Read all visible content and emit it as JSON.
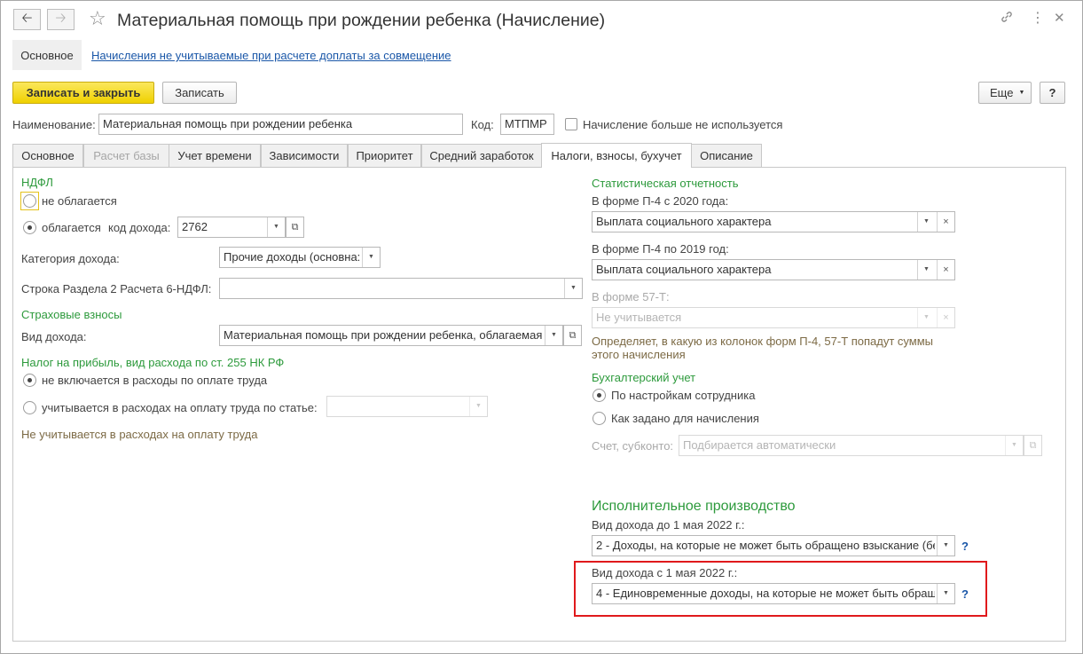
{
  "window": {
    "title": "Материальная помощь при рождении ребенка (Начисление)"
  },
  "icons": {
    "back": "arrow-left-icon",
    "forward": "arrow-right-icon",
    "favorite": "star-icon",
    "link": "link-icon",
    "menu": "more-vertical-icon",
    "close": "close-icon"
  },
  "top_nav": {
    "main": "Основное",
    "link": "Начисления не учитываемые при расчете доплаты за совмещение"
  },
  "toolbar": {
    "save_close": "Записать и закрыть",
    "save": "Записать",
    "more": "Еще",
    "help": "?"
  },
  "header": {
    "name_label": "Наименование:",
    "name_value": "Материальная помощь при рождении ребенка",
    "code_label": "Код:",
    "code_value": "МТПМР",
    "unused_label": "Начисление больше не используется"
  },
  "tabs": [
    {
      "label": "Основное"
    },
    {
      "label": "Расчет базы"
    },
    {
      "label": "Учет времени"
    },
    {
      "label": "Зависимости"
    },
    {
      "label": "Приоритет"
    },
    {
      "label": "Средний заработок"
    },
    {
      "label": "Налоги, взносы, бухучет"
    },
    {
      "label": "Описание"
    }
  ],
  "ndfl": {
    "title": "НДФЛ",
    "not_taxed": "не облагается",
    "taxed": "облагается",
    "income_code_label": "код дохода:",
    "income_code": "2762",
    "category_label": "Категория дохода:",
    "category_value": "Прочие доходы (основна:",
    "line_label": "Строка Раздела 2 Расчета 6-НДФЛ:",
    "line_value": ""
  },
  "insurance": {
    "title": "Страховые взносы",
    "income_type_label": "Вид дохода:",
    "income_type_value": "Материальная помощь при рождении ребенка, облагаемая"
  },
  "profit_tax": {
    "title": "Налог на прибыль, вид расхода по ст. 255 НК РФ",
    "not_included": "не включается в расходы по оплате труда",
    "included": "учитывается в расходах на оплату труда по статье:",
    "note": "Не учитывается в расходах на оплату труда"
  },
  "stats": {
    "title": "Статистическая отчетность",
    "p4_2020_label": "В форме П-4 с 2020 года:",
    "p4_2020_value": "Выплата социального характера",
    "p4_2019_label": "В форме П-4 по 2019 год:",
    "p4_2019_value": "Выплата социального характера",
    "f57_label": "В форме 57-Т:",
    "f57_value": "Не учитывается",
    "note_line1": "Определяет, в какую из колонок форм П-4, 57-Т попадут суммы",
    "note_line2": "этого начисления"
  },
  "accounting": {
    "title": "Бухгалтерский учет",
    "by_employee": "По настройкам сотрудника",
    "as_set": "Как задано для начисления",
    "account_label": "Счет, субконто:",
    "account_value": "Подбирается автоматически"
  },
  "enforcement": {
    "title": "Исполнительное производство",
    "before_label": "Вид дохода до 1 мая 2022 г.:",
    "before_value": "2 - Доходы, на которые не может быть обращено взыскание (бе",
    "after_label": "Вид дохода с 1 мая 2022 г.:",
    "after_value": "4 - Единовременные доходы, на которые не может быть обращ",
    "help": "?"
  }
}
